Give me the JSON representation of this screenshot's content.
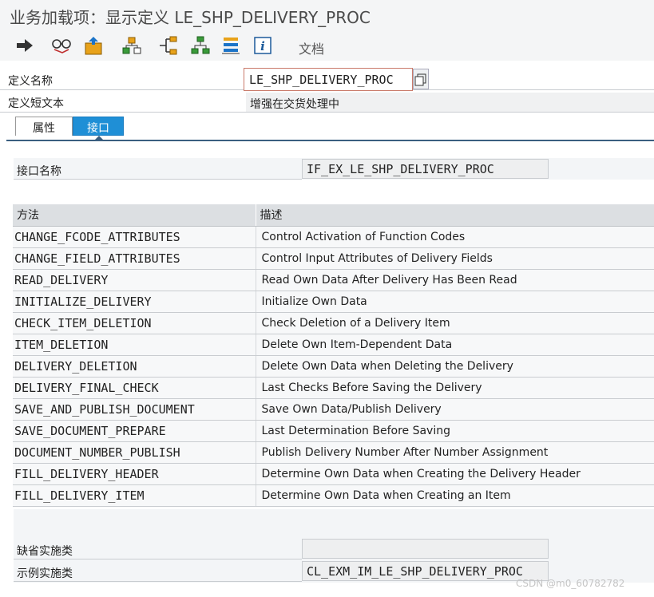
{
  "window": {
    "title": "业务加载项：显示定义 LE_SHP_DELIVERY_PROC"
  },
  "toolbar": {
    "buttons": [
      {
        "icon": "arrow-right-icon"
      },
      {
        "icon": "glasses-icon"
      },
      {
        "icon": "transport-icon"
      },
      {
        "icon": "hierarchy-icon"
      },
      {
        "icon": "branch-icon"
      },
      {
        "icon": "org-chart-icon"
      },
      {
        "icon": "list-stack-icon"
      },
      {
        "icon": "info-icon"
      }
    ],
    "doc_label": "文档"
  },
  "definition": {
    "name_label": "定义名称",
    "name_value": "LE_SHP_DELIVERY_PROC",
    "short_text_label": "定义短文本",
    "short_text_value": "增强在交货处理中"
  },
  "tabs": [
    {
      "label": "属性",
      "active": false
    },
    {
      "label": "接口",
      "active": true
    }
  ],
  "interface": {
    "name_label": "接口名称",
    "name_value": "IF_EX_LE_SHP_DELIVERY_PROC"
  },
  "methods": {
    "columns": [
      "方法",
      "描述"
    ],
    "rows": [
      {
        "method": "CHANGE_FCODE_ATTRIBUTES",
        "description": "Control Activation of Function Codes"
      },
      {
        "method": "CHANGE_FIELD_ATTRIBUTES",
        "description": "Control Input Attributes of Delivery Fields"
      },
      {
        "method": "READ_DELIVERY",
        "description": "Read Own Data After Delivery Has Been Read"
      },
      {
        "method": "INITIALIZE_DELIVERY",
        "description": "Initialize Own Data"
      },
      {
        "method": "CHECK_ITEM_DELETION",
        "description": "Check Deletion of a Delivery Item"
      },
      {
        "method": "ITEM_DELETION",
        "description": "Delete Own Item-Dependent Data"
      },
      {
        "method": "DELIVERY_DELETION",
        "description": "Delete Own Data when Deleting the Delivery"
      },
      {
        "method": "DELIVERY_FINAL_CHECK",
        "description": "Last Checks Before Saving the Delivery"
      },
      {
        "method": "SAVE_AND_PUBLISH_DOCUMENT",
        "description": "Save Own Data/Publish Delivery"
      },
      {
        "method": "SAVE_DOCUMENT_PREPARE",
        "description": "Last Determination Before Saving"
      },
      {
        "method": "DOCUMENT_NUMBER_PUBLISH",
        "description": "Publish Delivery Number After Number Assignment"
      },
      {
        "method": "FILL_DELIVERY_HEADER",
        "description": "Determine Own Data when Creating the Delivery Header"
      },
      {
        "method": "FILL_DELIVERY_ITEM",
        "description": "Determine Own Data when Creating an Item"
      }
    ]
  },
  "implementation": {
    "default_label": "缺省实施类",
    "default_value": "",
    "example_label": "示例实施类",
    "example_value": "CL_EXM_IM_LE_SHP_DELIVERY_PROC"
  },
  "watermark": "CSDN @m0_60782782",
  "colors": {
    "active_tab": "#1f8fd6",
    "header_bg": "#dcdfe2",
    "field_bg": "#eeeff0"
  }
}
